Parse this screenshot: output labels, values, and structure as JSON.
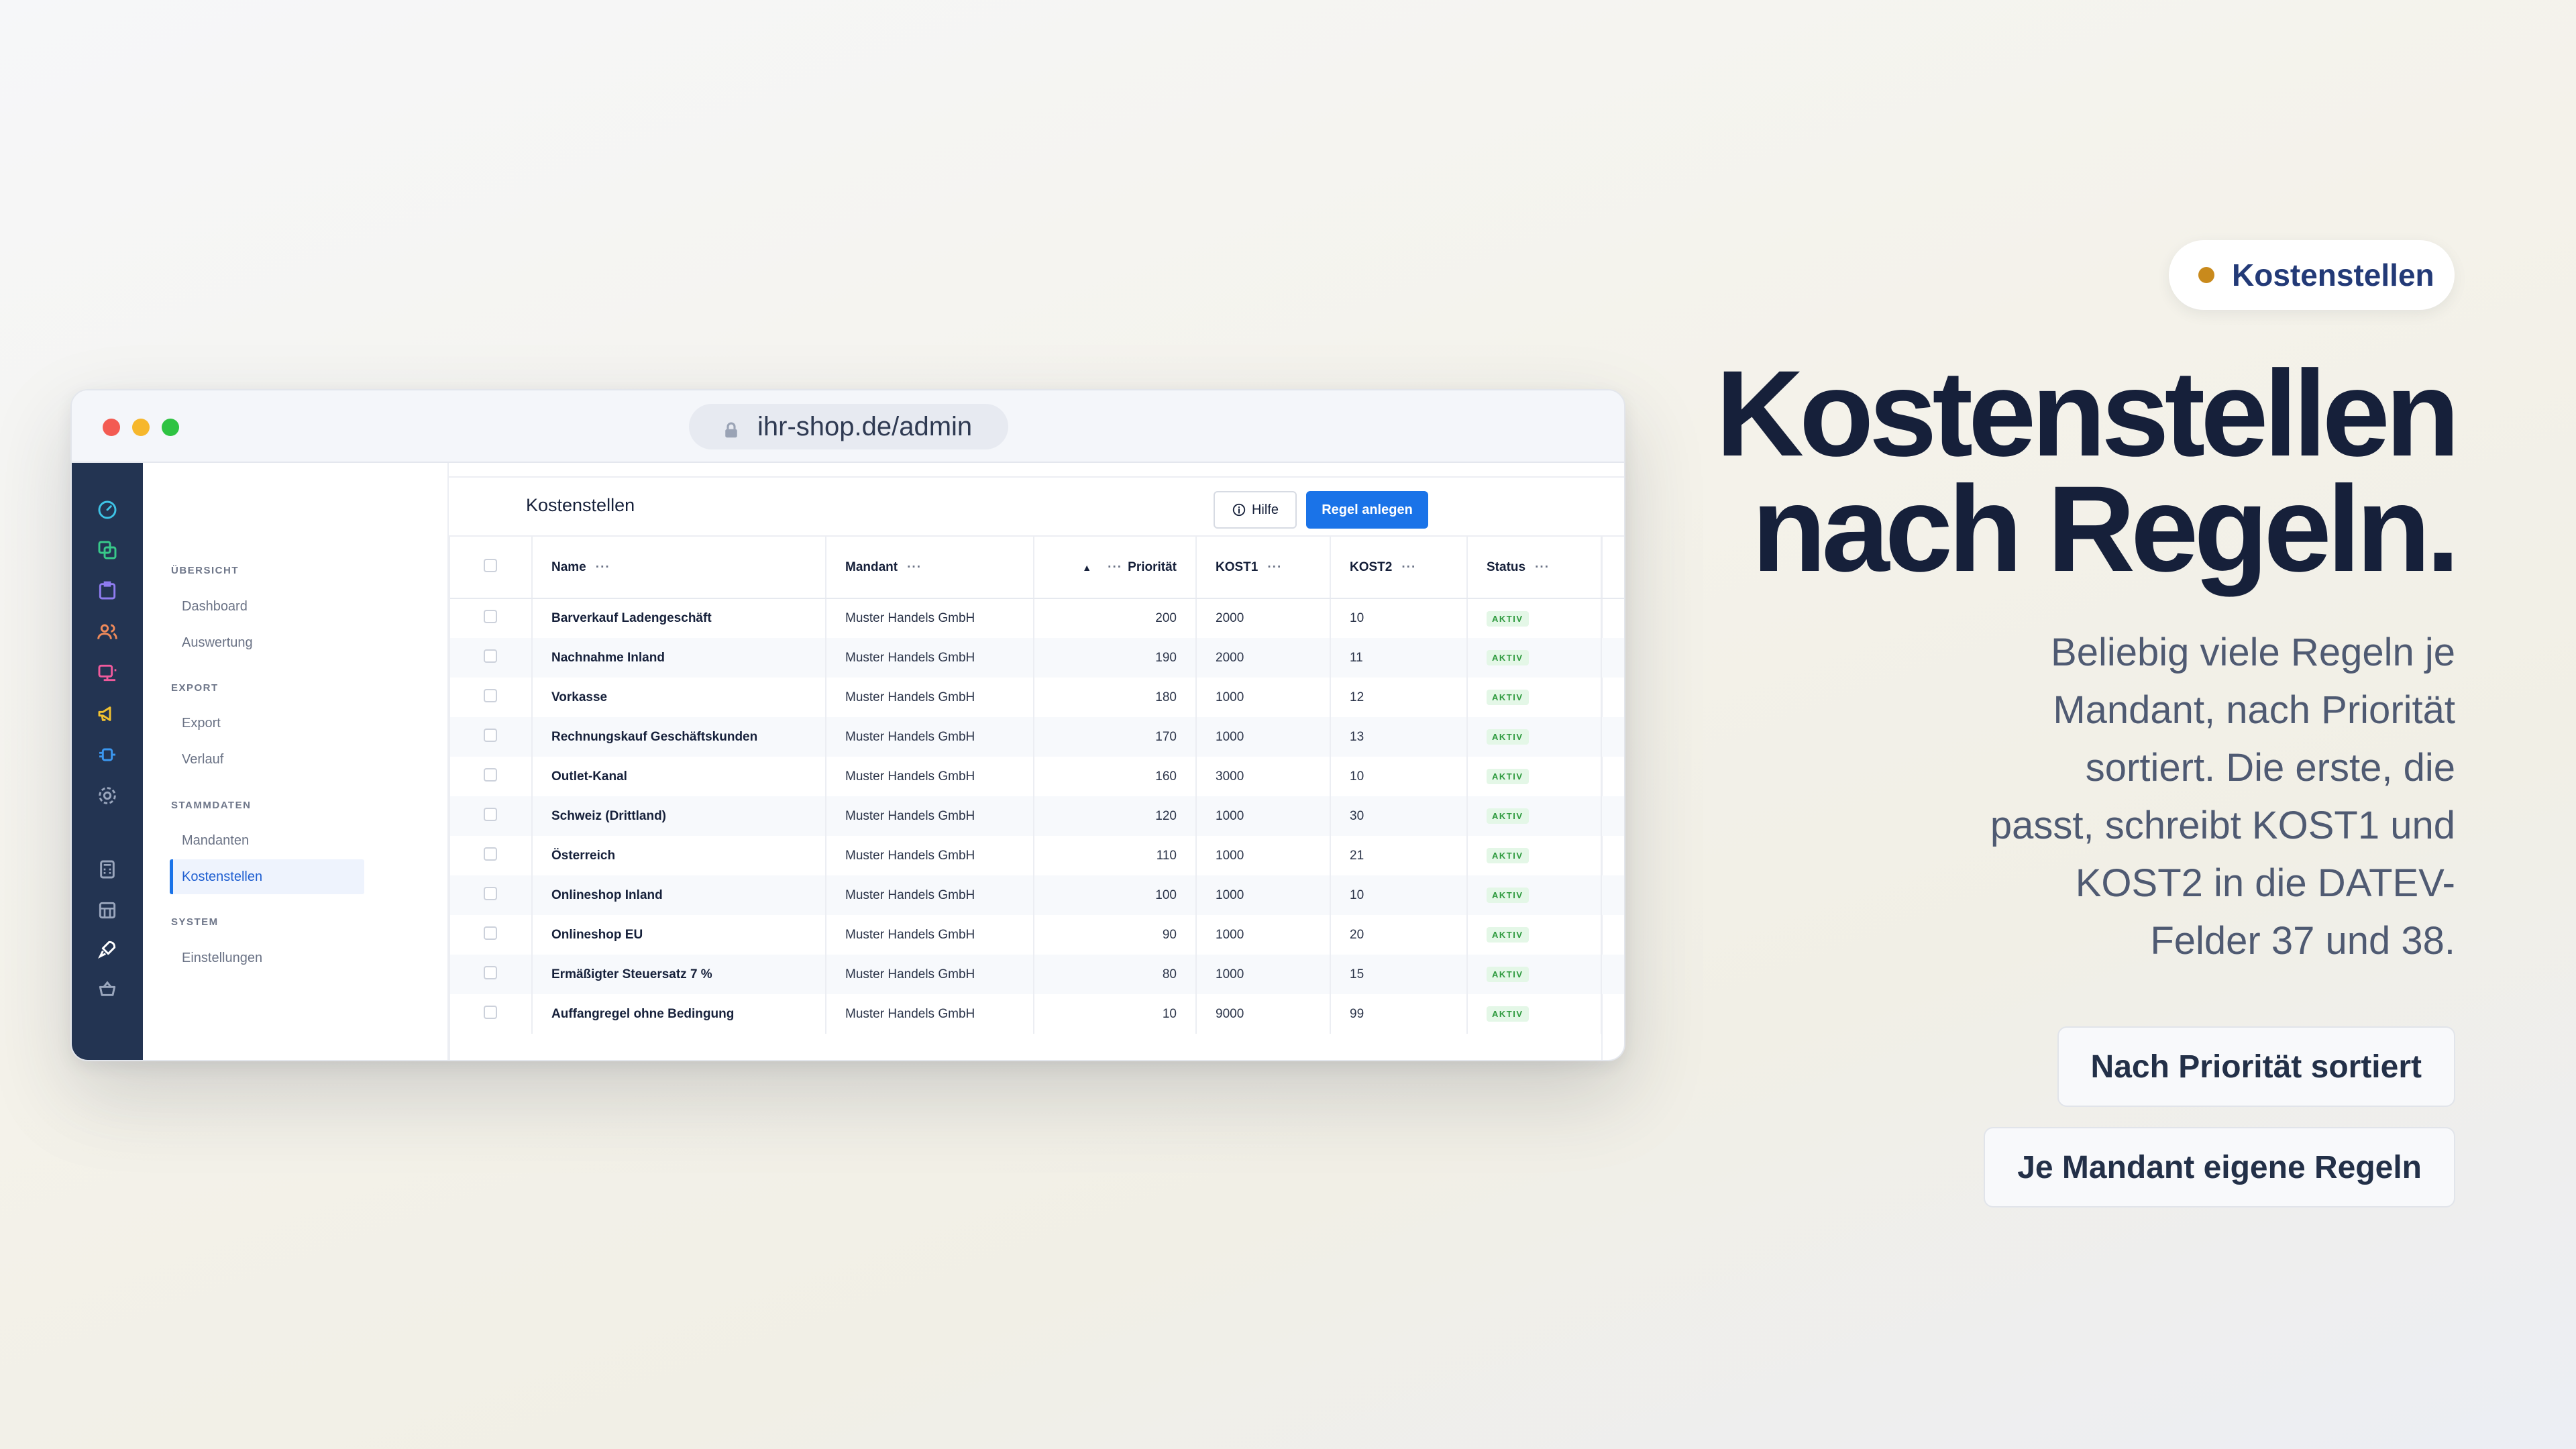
{
  "browser": {
    "url": "ihr-shop.de/admin"
  },
  "nav": {
    "sections": [
      {
        "title": "ÜBERSICHT",
        "items": [
          "Dashboard",
          "Auswertung"
        ]
      },
      {
        "title": "EXPORT",
        "items": [
          "Export",
          "Verlauf"
        ]
      },
      {
        "title": "STAMMDATEN",
        "items": [
          "Mandanten",
          "Kostenstellen"
        ]
      },
      {
        "title": "SYSTEM",
        "items": [
          "Einstellungen"
        ]
      }
    ],
    "active_item": "Kostenstellen"
  },
  "rail_icons": [
    {
      "name": "dashboard-gauge-icon",
      "color": "#3ec3e6"
    },
    {
      "name": "copy-icon",
      "color": "#38c98a"
    },
    {
      "name": "clipboard-icon",
      "color": "#8f7cf0"
    },
    {
      "name": "users-icon",
      "color": "#f08a5a"
    },
    {
      "name": "list-icon",
      "color": "#f05a9c"
    },
    {
      "name": "megaphone-icon",
      "color": "#f2c230"
    },
    {
      "name": "plug-icon",
      "color": "#3b97f0"
    },
    {
      "name": "settings-icon",
      "color": "#9aa6bd"
    },
    {
      "name": "calculator-icon",
      "color": "#9aa6bd"
    },
    {
      "name": "calendar-grid-icon",
      "color": "#9aa6bd"
    },
    {
      "name": "rocket-icon",
      "color": "#ffffff"
    },
    {
      "name": "basket-icon",
      "color": "#9aa6bd"
    }
  ],
  "page": {
    "title": "Kostenstellen",
    "help_label": "Hilfe",
    "new_rule_label": "Regel anlegen"
  },
  "table": {
    "columns": {
      "name": "Name",
      "mandant": "Mandant",
      "prioritaet": "Priorität",
      "kost1": "KOST1",
      "kost2": "KOST2",
      "status": "Status"
    },
    "rows": [
      {
        "name": "Barverkauf Ladengeschäft",
        "mandant": "Muster Handels GmbH",
        "prioritaet": "200",
        "kost1": "2000",
        "kost2": "10",
        "status": "AKTIV"
      },
      {
        "name": "Nachnahme Inland",
        "mandant": "Muster Handels GmbH",
        "prioritaet": "190",
        "kost1": "2000",
        "kost2": "11",
        "status": "AKTIV"
      },
      {
        "name": "Vorkasse",
        "mandant": "Muster Handels GmbH",
        "prioritaet": "180",
        "kost1": "1000",
        "kost2": "12",
        "status": "AKTIV"
      },
      {
        "name": "Rechnungskauf Geschäftskunden",
        "mandant": "Muster Handels GmbH",
        "prioritaet": "170",
        "kost1": "1000",
        "kost2": "13",
        "status": "AKTIV"
      },
      {
        "name": "Outlet-Kanal",
        "mandant": "Muster Handels GmbH",
        "prioritaet": "160",
        "kost1": "3000",
        "kost2": "10",
        "status": "AKTIV"
      },
      {
        "name": "Schweiz (Drittland)",
        "mandant": "Muster Handels GmbH",
        "prioritaet": "120",
        "kost1": "1000",
        "kost2": "30",
        "status": "AKTIV"
      },
      {
        "name": "Österreich",
        "mandant": "Muster Handels GmbH",
        "prioritaet": "110",
        "kost1": "1000",
        "kost2": "21",
        "status": "AKTIV"
      },
      {
        "name": "Onlineshop Inland",
        "mandant": "Muster Handels GmbH",
        "prioritaet": "100",
        "kost1": "1000",
        "kost2": "10",
        "status": "AKTIV"
      },
      {
        "name": "Onlineshop EU",
        "mandant": "Muster Handels GmbH",
        "prioritaet": "90",
        "kost1": "1000",
        "kost2": "20",
        "status": "AKTIV"
      },
      {
        "name": "Ermäßigter Steuersatz 7 %",
        "mandant": "Muster Handels GmbH",
        "prioritaet": "80",
        "kost1": "1000",
        "kost2": "15",
        "status": "AKTIV"
      },
      {
        "name": "Auffangregel ohne Bedingung",
        "mandant": "Muster Handels GmbH",
        "prioritaet": "10",
        "kost1": "9000",
        "kost2": "99",
        "status": "AKTIV"
      }
    ]
  },
  "marketing": {
    "pill_label": "Kostenstellen",
    "headline_line1": "Kostenstellen",
    "headline_line2": "nach Regeln.",
    "subtext_lines": [
      "Beliebig viele Regeln je",
      "Mandant, nach Priorität",
      "sortiert. Die erste, die",
      "passt, schreibt KOST1 und",
      "KOST2 in die DATEV-",
      "Felder 37 und 38."
    ],
    "chip1": "Nach Priorität sortiert",
    "chip2": "Je Mandant eigene Regeln"
  },
  "colors": {
    "accent": "#1a73e8",
    "rail_bg": "#233452",
    "headline": "#16203a",
    "status_active": "#2e9a3e",
    "pill_dot": "#c98a1c"
  }
}
